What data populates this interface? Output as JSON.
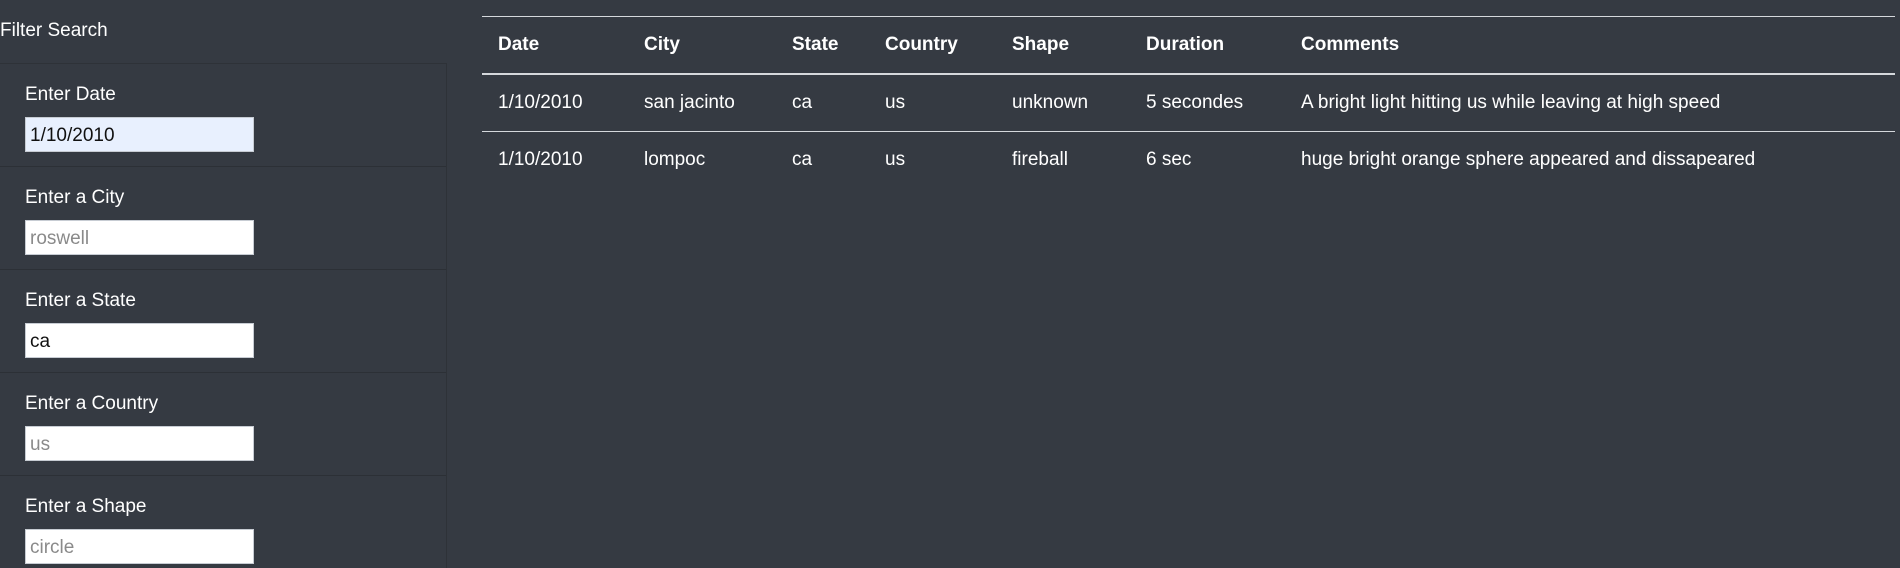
{
  "filter": {
    "title": "Filter Search",
    "fields": [
      {
        "label": "Enter Date",
        "value": "1/10/2010",
        "placeholder": ""
      },
      {
        "label": "Enter a City",
        "value": "",
        "placeholder": "roswell"
      },
      {
        "label": "Enter a State",
        "value": "ca",
        "placeholder": ""
      },
      {
        "label": "Enter a Country",
        "value": "",
        "placeholder": "us"
      },
      {
        "label": "Enter a Shape",
        "value": "",
        "placeholder": "circle"
      }
    ]
  },
  "table": {
    "columns": [
      "Date",
      "City",
      "State",
      "Country",
      "Shape",
      "Duration",
      "Comments"
    ],
    "rows": [
      [
        "1/10/2010",
        "san jacinto",
        "ca",
        "us",
        "unknown",
        "5 secondes",
        "A bright light hitting us while leaving at high speed"
      ],
      [
        "1/10/2010",
        "lompoc",
        "ca",
        "us",
        "fireball",
        "6 sec",
        "huge bright orange sphere appeared and dissapeared"
      ]
    ]
  },
  "colors": {
    "background": "#353a42",
    "text": "#ffffff",
    "rule": "#d5d8dc",
    "autofill": "#e8f0fe"
  }
}
